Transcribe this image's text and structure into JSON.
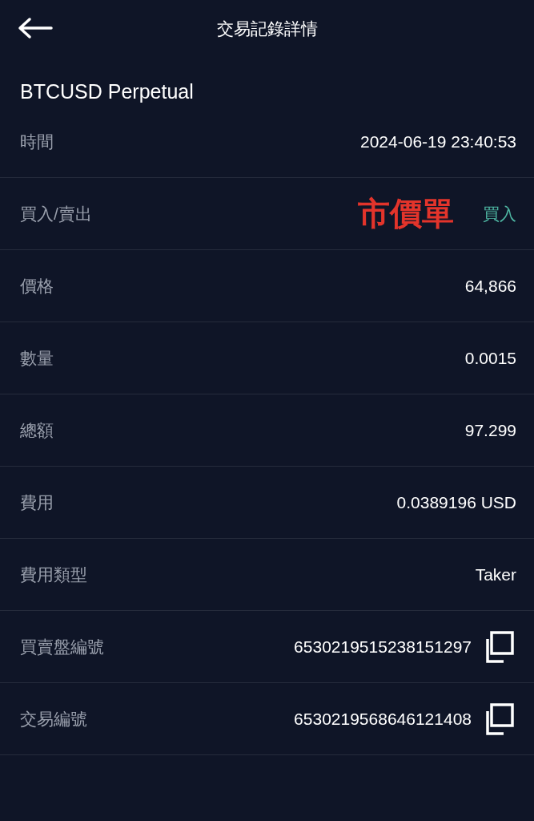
{
  "header": {
    "title": "交易記錄詳情"
  },
  "instrument": "BTCUSD Perpetual",
  "rows": [
    {
      "kind": "plain",
      "label": "時間",
      "value": "2024-06-19 23:40:53"
    },
    {
      "kind": "side",
      "label": "買入/賣出",
      "annotation": "市價單",
      "value": "買入",
      "color": "#4fb8a4"
    },
    {
      "kind": "plain",
      "label": "價格",
      "value": "64,866"
    },
    {
      "kind": "plain",
      "label": "數量",
      "value": "0.0015"
    },
    {
      "kind": "plain",
      "label": "總額",
      "value": "97.299"
    },
    {
      "kind": "plain",
      "label": "費用",
      "value": "0.0389196 USD"
    },
    {
      "kind": "plain",
      "label": "費用類型",
      "value": "Taker"
    },
    {
      "kind": "copy",
      "label": "買賣盤編號",
      "value": "6530219515238151297"
    },
    {
      "kind": "copy",
      "label": "交易編號",
      "value": "6530219568646121408"
    }
  ]
}
